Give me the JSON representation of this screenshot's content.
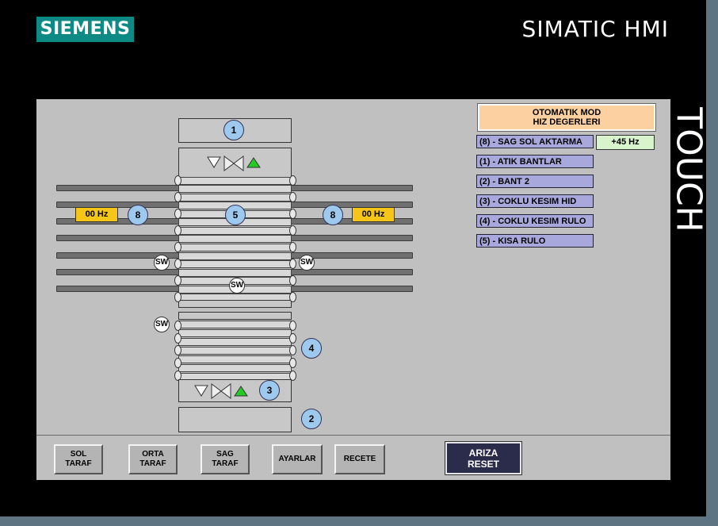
{
  "header": {
    "brand": "SIEMENS",
    "product": "SIMATIC HMI",
    "touch": "TOUCH"
  },
  "mode": {
    "line1": "OTOMATIK MOD",
    "line2": "HIZ DEGERLERI"
  },
  "speed_list": [
    {
      "label": "(8) - SAG SOL AKTARMA",
      "value": "+45 Hz"
    },
    {
      "label": "(1) - ATIK BANTLAR"
    },
    {
      "label": "(2) - BANT 2"
    },
    {
      "label": "(3) - COKLU KESIM HID"
    },
    {
      "label": "(4) - COKLU KESIM RULO"
    },
    {
      "label": "(5) - KISA RULO"
    }
  ],
  "diagram": {
    "badges": [
      "1",
      "5",
      "8",
      "8",
      "4",
      "3",
      "2"
    ],
    "hz_left": "00 Hz",
    "hz_right": "00 Hz",
    "sw": "SW"
  },
  "nav": {
    "left_line1": "SOL",
    "left_line2": "TARAF",
    "center_line1": "ORTA",
    "center_line2": "TARAF",
    "right_line1": "SAG",
    "right_line2": "TARAF",
    "settings": "AYARLAR",
    "recipe": "RECETE",
    "reset_line1": "ARIZA",
    "reset_line2": "RESET"
  },
  "colors": {
    "brand": "#0e8a84",
    "badge": "#9ec9ee",
    "hz": "#f5c517",
    "mode": "#fcd0a0",
    "speed": "#a8a8dc",
    "reset": "#2b2b4c"
  }
}
